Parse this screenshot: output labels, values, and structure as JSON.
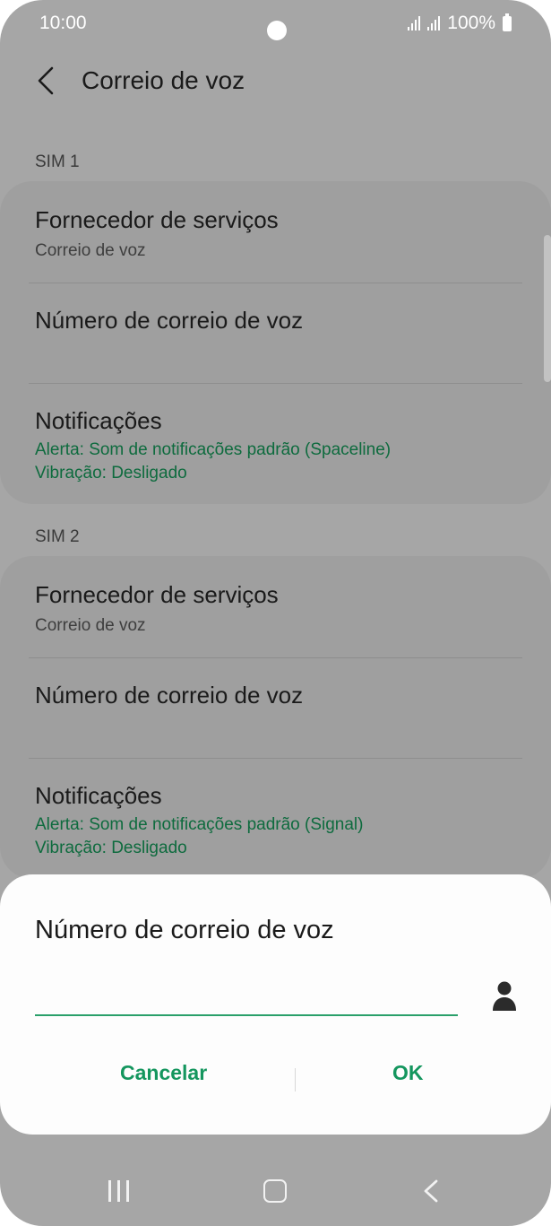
{
  "status_bar": {
    "time": "10:00",
    "battery": "100%"
  },
  "header": {
    "title": "Correio de voz"
  },
  "sections": [
    {
      "label": "SIM 1",
      "items": [
        {
          "title": "Fornecedor de serviços",
          "subtitle": "Correio de voz"
        },
        {
          "title": "Número de correio de voz"
        },
        {
          "title": "Notificações",
          "line1": "Alerta: Som de notificações padrão (Spaceline)",
          "line2": "Vibração: Desligado"
        }
      ]
    },
    {
      "label": "SIM 2",
      "items": [
        {
          "title": "Fornecedor de serviços",
          "subtitle": "Correio de voz"
        },
        {
          "title": "Número de correio de voz"
        },
        {
          "title": "Notificações",
          "line1": "Alerta: Som de notificações padrão (Signal)",
          "line2": "Vibração: Desligado"
        }
      ]
    }
  ],
  "dialog": {
    "title": "Número de correio de voz",
    "input_value": "",
    "cancel_label": "Cancelar",
    "ok_label": "OK"
  },
  "colors": {
    "accent": "#14965e",
    "secondary_text": "#0e6b3e",
    "dialog_bg": "#fdfdfd",
    "dim_bg": "#a6a6a6"
  },
  "icons": {
    "back": "chevron-left-icon",
    "contact": "person-icon",
    "nav_recent": "recent-apps-icon",
    "nav_home": "home-icon",
    "nav_back": "back-icon"
  }
}
